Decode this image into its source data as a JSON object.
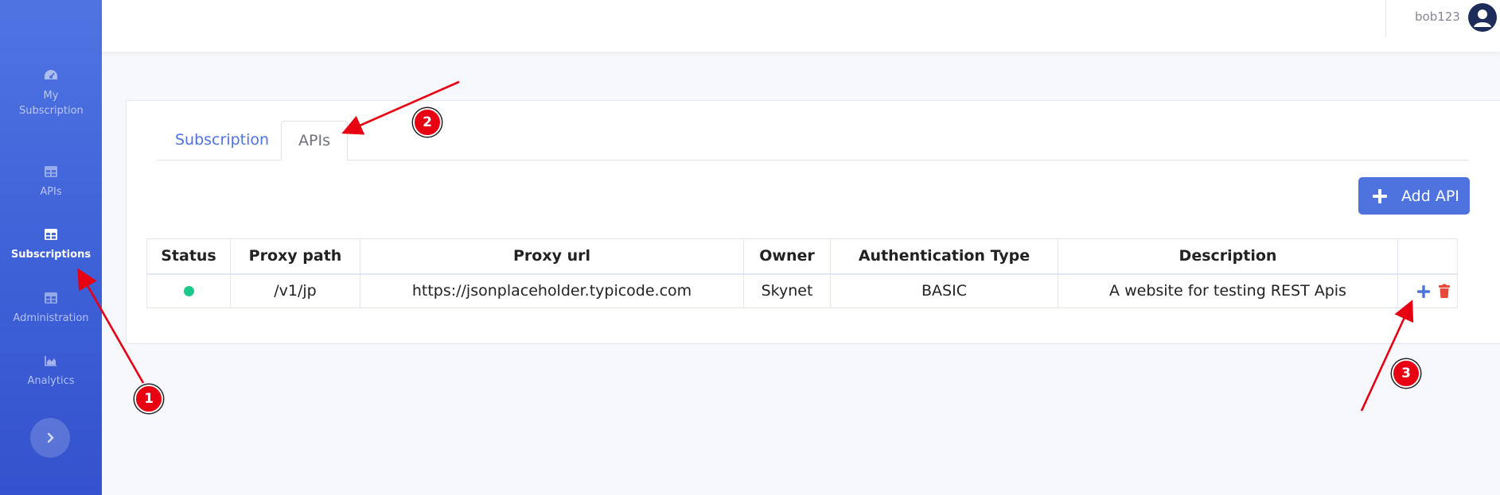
{
  "sidebar": {
    "items": [
      {
        "label": "My Subscription",
        "icon": "dashboard-gauge-icon"
      },
      {
        "label": "APIs",
        "icon": "table-icon"
      },
      {
        "label": "Subscriptions",
        "icon": "table-icon",
        "active": true
      },
      {
        "label": "Administration",
        "icon": "table-icon"
      },
      {
        "label": "Analytics",
        "icon": "area-chart-icon"
      }
    ],
    "toggle_icon": "chevron-right-icon"
  },
  "header": {
    "username": "bob123",
    "avatar_icon": "user-circle-icon"
  },
  "tabs": [
    {
      "label": "Subscription",
      "active": false
    },
    {
      "label": "APIs",
      "active": true
    }
  ],
  "add_button": {
    "label": "Add API",
    "icon": "plus-icon"
  },
  "table": {
    "columns": [
      "Status",
      "Proxy path",
      "Proxy url",
      "Owner",
      "Authentication Type",
      "Description",
      ""
    ],
    "rows": [
      {
        "status": "active",
        "proxy_path": "/v1/jp",
        "proxy_url": "https://jsonplaceholder.typicode.com",
        "owner": "Skynet",
        "auth_type": "BASIC",
        "description": "A website for testing REST Apis",
        "actions": [
          "plus-icon",
          "trash-icon"
        ]
      }
    ]
  },
  "annotations": [
    {
      "label": "1"
    },
    {
      "label": "2"
    },
    {
      "label": "3"
    }
  ],
  "colors": {
    "primary": "#4e73df",
    "sidebar": "#3c5fd6",
    "status_active": "#1cc88a",
    "delete": "#e74a3b",
    "annotation": "#e60012"
  }
}
